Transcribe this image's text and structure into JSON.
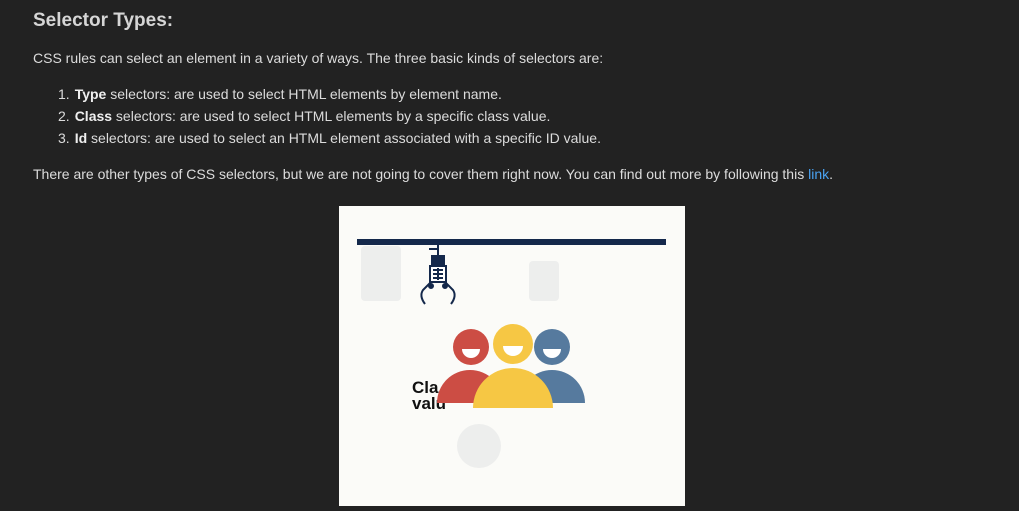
{
  "title": "Selector Types:",
  "intro": "CSS rules can select an element in a variety of ways. The three basic kinds of selectors are:",
  "list": [
    {
      "num": "1.",
      "bold": "Type",
      "rest": " selectors: are used to select HTML elements by element name."
    },
    {
      "num": "2.",
      "bold": "Class",
      "rest": " selectors: are used to select HTML elements by a specific class value."
    },
    {
      "num": "3.",
      "bold": "Id",
      "rest": " selectors: are used to select an HTML element associated with a specific ID value."
    }
  ],
  "outro": {
    "text": "There are other types of CSS selectors, but we are not going to cover them right now. You can find out more by following this ",
    "link_label": "link",
    "end": "."
  },
  "figure": {
    "caption_line1": "Cla",
    "caption_line2": "valu",
    "colors": {
      "rail": "#14284b",
      "red": "#cc4d44",
      "yellow": "#f6c744",
      "blue": "#567a9e",
      "background": "#fbfbf8"
    }
  }
}
